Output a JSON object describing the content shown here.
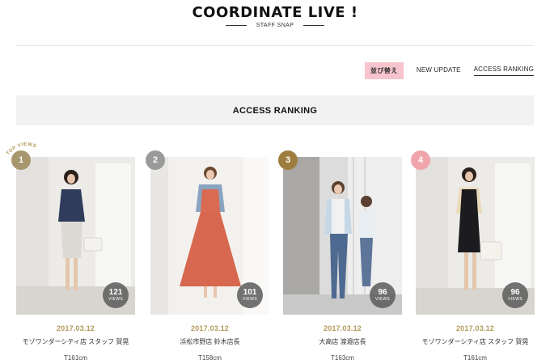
{
  "header": {
    "title": "COORDINATE LIVE !",
    "subtitle": "STAFF SNAP"
  },
  "sort": {
    "label": "並び替え",
    "options": [
      {
        "label": "NEW UPDATE",
        "active": false
      },
      {
        "label": "ACCESS RANKING",
        "active": true
      }
    ]
  },
  "section_title": "ACCESS RANKING",
  "top_views_label": "TOP VIEWS",
  "cards": [
    {
      "rank": "1",
      "badge_color": "#a8966c",
      "views": "121",
      "views_label": "VIEWS",
      "date": "2017.03.12",
      "staff": "モゾワンダーシティ店 スタッフ 賀晃",
      "height": "T161cm"
    },
    {
      "rank": "2",
      "badge_color": "#9a9a9a",
      "views": "101",
      "views_label": "VIEWS",
      "date": "2017.03.12",
      "staff": "浜松市野店 鈴木店長",
      "height": "T158cm"
    },
    {
      "rank": "3",
      "badge_color": "#9e7e40",
      "views": "96",
      "views_label": "VIEWS",
      "date": "2017.03.12",
      "staff": "大高店 渡邉店長",
      "height": "T163cm"
    },
    {
      "rank": "4",
      "badge_color": "#f0a5ad",
      "views": "96",
      "views_label": "VIEWS",
      "date": "2017.03.12",
      "staff": "モゾワンダーシティ店 スタッフ 賀晃",
      "height": "T161cm"
    }
  ]
}
